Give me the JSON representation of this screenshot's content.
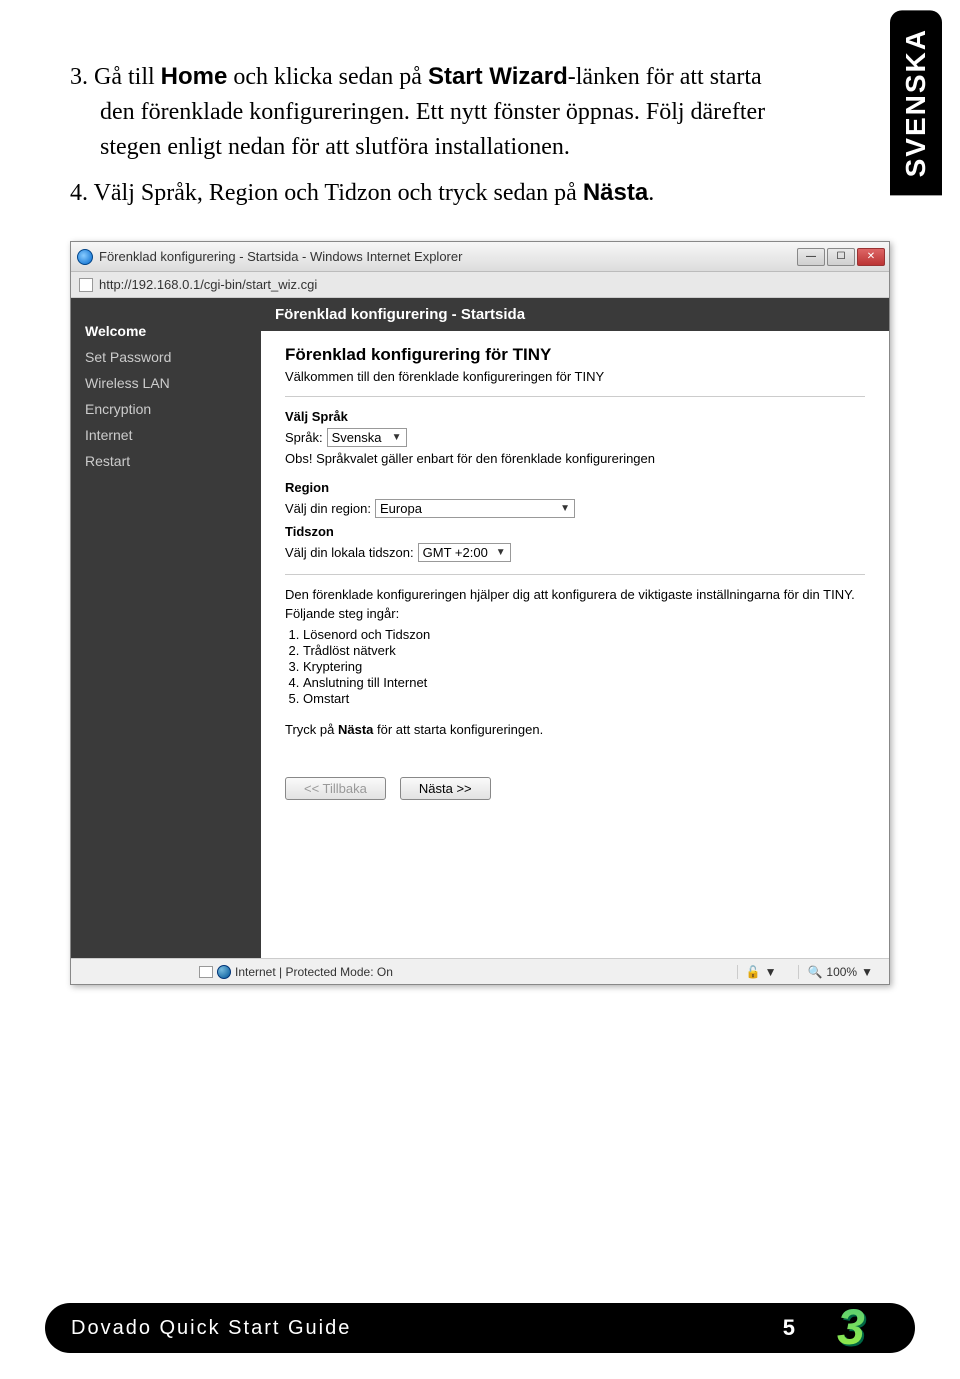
{
  "side_tab": "SVENSKA",
  "instructions": {
    "item3_prefix": "3.  Gå till ",
    "item3_bold1": "Home",
    "item3_mid1": " och klicka sedan på ",
    "item3_bold2": "Start Wizard",
    "item3_rest": "-länken för att starta den förenklade konfigureringen. Ett nytt fönster öppnas. Följ därefter stegen enligt nedan för att slutföra installationen.",
    "item4_prefix": "4.  Välj Språk, Region och Tidzon och tryck sedan på ",
    "item4_bold": "Nästa",
    "item4_end": "."
  },
  "browser": {
    "title": "Förenklad konfigurering - Startsida - Windows Internet Explorer",
    "url": "http://192.168.0.1/cgi-bin/start_wiz.cgi"
  },
  "sidebar": {
    "items": [
      "Welcome",
      "Set Password",
      "Wireless LAN",
      "Encryption",
      "Internet",
      "Restart"
    ],
    "active_index": 0
  },
  "main": {
    "header": "Förenklad konfigurering - Startsida",
    "h2": "Förenklad konfigurering för TINY",
    "sub": "Välkommen till den förenklade konfigureringen för TINY",
    "lang_section": "Välj Språk",
    "lang_label": "Språk:",
    "lang_value": "Svenska",
    "lang_note": "Obs! Språkvalet gäller enbart för den förenklade konfigureringen",
    "region_section": "Region",
    "region_label": "Välj din region:",
    "region_value": "Europa",
    "tz_section": "Tidszon",
    "tz_label": "Välj din lokala tidszon:",
    "tz_value": "GMT +2:00",
    "help1": "Den förenklade konfigureringen hjälper dig att konfigurera de viktigaste inställningarna för din TINY.",
    "help2": "Följande steg ingår:",
    "steps": [
      "Lösenord och Tidszon",
      "Trådlöst nätverk",
      "Kryptering",
      "Anslutning till Internet",
      "Omstart"
    ],
    "press_prefix": "Tryck på ",
    "press_bold": "Nästa",
    "press_suffix": " för att starta konfigureringen.",
    "back": "<< Tillbaka",
    "next": "Nästa >>"
  },
  "statusbar": {
    "mode": "Internet | Protected Mode: On",
    "zoom": "100%"
  },
  "footer": {
    "title": "Dovado Quick Start Guide",
    "page": "5"
  }
}
